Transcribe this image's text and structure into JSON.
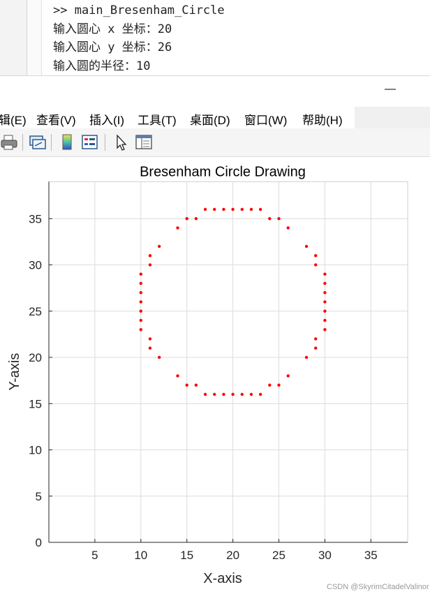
{
  "console": {
    "lines": [
      ">> main_Bresenham_Circle",
      "输入圆心 x 坐标：20",
      "输入圆心 y 坐标：26",
      "输入圆的半径：10"
    ]
  },
  "window": {
    "minimize_glyph": "—"
  },
  "menu": [
    {
      "label": "辑(E)"
    },
    {
      "label": "查看(V)"
    },
    {
      "label": "插入(I)"
    },
    {
      "label": "工具(T)"
    },
    {
      "label": "桌面(D)"
    },
    {
      "label": "窗口(W)"
    },
    {
      "label": "帮助(H)"
    }
  ],
  "toolbar": {
    "buttons": [
      "print-icon",
      "link-figure-icon",
      "colorbar-icon",
      "legend-icon",
      "pointer-icon",
      "property-inspector-icon"
    ]
  },
  "chart_data": {
    "type": "scatter",
    "title": "Bresenham Circle Drawing",
    "xlabel": "X-axis",
    "ylabel": "Y-axis",
    "xlim": [
      0,
      39
    ],
    "ylim": [
      0,
      39
    ],
    "xticks": [
      5,
      10,
      15,
      20,
      25,
      30,
      35
    ],
    "yticks": [
      0,
      5,
      10,
      15,
      20,
      25,
      30,
      35
    ],
    "grid": true,
    "marker_color": "#ff0000",
    "series": [
      {
        "points": [
          [
            17,
            36
          ],
          [
            18,
            36
          ],
          [
            19,
            36
          ],
          [
            20,
            36
          ],
          [
            21,
            36
          ],
          [
            22,
            36
          ],
          [
            23,
            36
          ],
          [
            15,
            35
          ],
          [
            16,
            35
          ],
          [
            24,
            35
          ],
          [
            25,
            35
          ],
          [
            14,
            34
          ],
          [
            26,
            34
          ],
          [
            12,
            32
          ],
          [
            28,
            32
          ],
          [
            11,
            31
          ],
          [
            29,
            31
          ],
          [
            11,
            30
          ],
          [
            29,
            30
          ],
          [
            10,
            29
          ],
          [
            30,
            29
          ],
          [
            10,
            28
          ],
          [
            30,
            28
          ],
          [
            10,
            27
          ],
          [
            30,
            27
          ],
          [
            10,
            26
          ],
          [
            30,
            26
          ],
          [
            10,
            25
          ],
          [
            30,
            25
          ],
          [
            10,
            24
          ],
          [
            30,
            24
          ],
          [
            10,
            23
          ],
          [
            30,
            23
          ],
          [
            11,
            22
          ],
          [
            29,
            22
          ],
          [
            11,
            21
          ],
          [
            29,
            21
          ],
          [
            12,
            20
          ],
          [
            28,
            20
          ],
          [
            14,
            18
          ],
          [
            26,
            18
          ],
          [
            15,
            17
          ],
          [
            16,
            17
          ],
          [
            24,
            17
          ],
          [
            25,
            17
          ],
          [
            17,
            16
          ],
          [
            18,
            16
          ],
          [
            19,
            16
          ],
          [
            20,
            16
          ],
          [
            21,
            16
          ],
          [
            22,
            16
          ],
          [
            23,
            16
          ]
        ]
      }
    ]
  },
  "watermark": "CSDN @SkyrimCitadelValinor"
}
